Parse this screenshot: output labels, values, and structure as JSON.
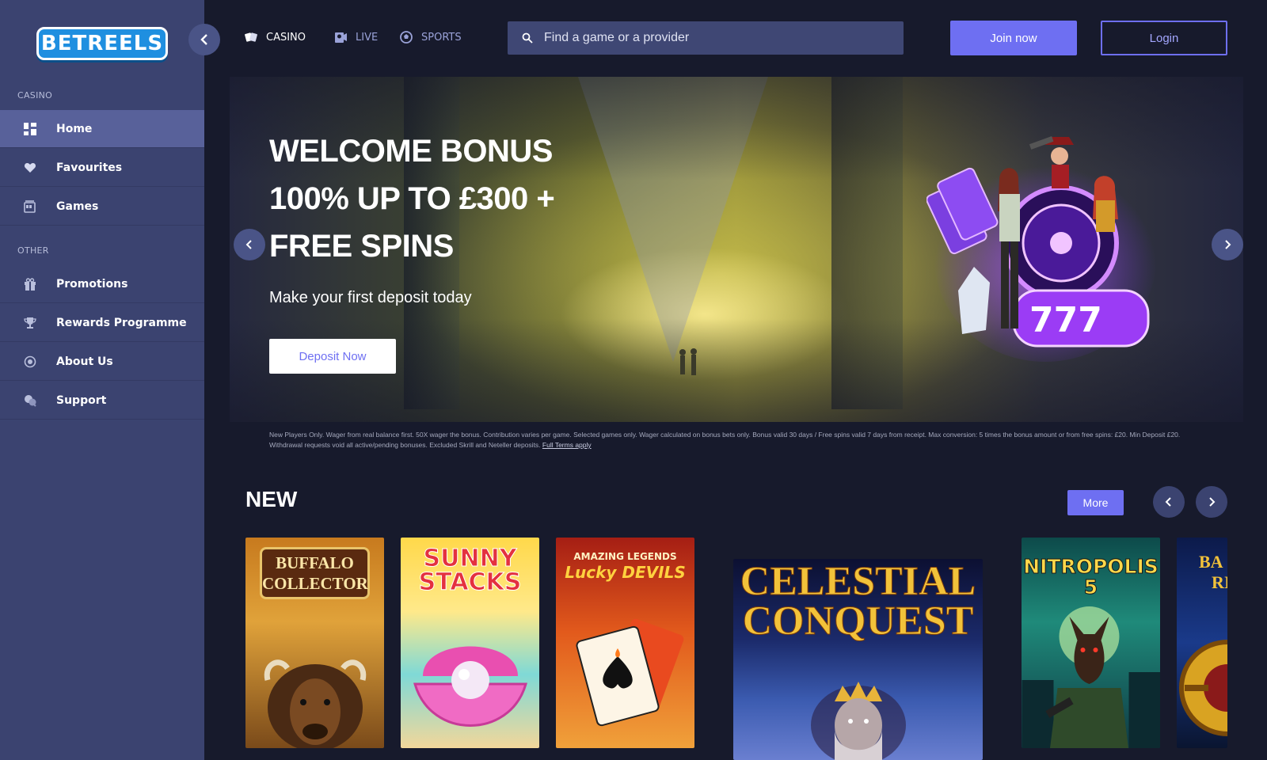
{
  "brand": {
    "logo_text": "BETREELS"
  },
  "sidebar": {
    "sections": [
      {
        "label": "CASINO"
      },
      {
        "label": "OTHER"
      }
    ],
    "items": [
      {
        "label": "Home",
        "icon": "grid-icon"
      },
      {
        "label": "Favourites",
        "icon": "heart-icon"
      },
      {
        "label": "Games",
        "icon": "slot-machine-icon"
      },
      {
        "label": "Promotions",
        "icon": "gift-icon"
      },
      {
        "label": "Rewards Programme",
        "icon": "trophy-icon"
      },
      {
        "label": "About Us",
        "icon": "info-circle-icon"
      },
      {
        "label": "Support",
        "icon": "chat-icon"
      }
    ]
  },
  "topnav": {
    "tabs": [
      {
        "label": "CASINO",
        "icon": "cards-icon"
      },
      {
        "label": "LIVE",
        "icon": "live-dealer-icon"
      },
      {
        "label": "SPORTS",
        "icon": "football-icon"
      }
    ],
    "search_placeholder": "Find a game or a provider",
    "join_label": "Join now",
    "login_label": "Login"
  },
  "hero": {
    "title_line1": "WELCOME BONUS",
    "title_line2": "100% UP TO £300 +",
    "title_line3": "FREE SPINS",
    "subtitle": "Make your first deposit today",
    "cta_label": "Deposit Now",
    "terms_text": "New Players Only. Wager from real balance first. 50X wager the bonus. Contribution varies per game. Selected games only. Wager calculated on bonus bets only. Bonus valid 30 days / Free spins valid 7 days from receipt. Max conversion: 5 times the bonus amount or from free spins: £20. Min Deposit £20. Withdrawal requests void all active/pending bonuses. Excluded Skrill and Neteller deposits.",
    "terms_link": "Full Terms apply"
  },
  "new_section": {
    "title": "NEW",
    "more_label": "More",
    "games": [
      {
        "title_line1": "BUFFALO",
        "title_line2": "COLLECTOR"
      },
      {
        "title_line1": "SUNNY",
        "title_line2": "STACKS"
      },
      {
        "title_line1": "AMAZING LEGENDS",
        "title_line2": "Lucky DEVILS"
      },
      {
        "title_line1": "CELESTIAL",
        "title_line2": "CONQUEST"
      },
      {
        "title_line1": "NITROPOLIS 5",
        "title_line2": ""
      },
      {
        "title_line1": "BA",
        "title_line2": "RI"
      }
    ]
  },
  "colors": {
    "accent": "#6e6ff2",
    "sidebar_bg": "#3b4370",
    "sidebar_active": "#58619a",
    "page_bg": "#171a2c"
  }
}
